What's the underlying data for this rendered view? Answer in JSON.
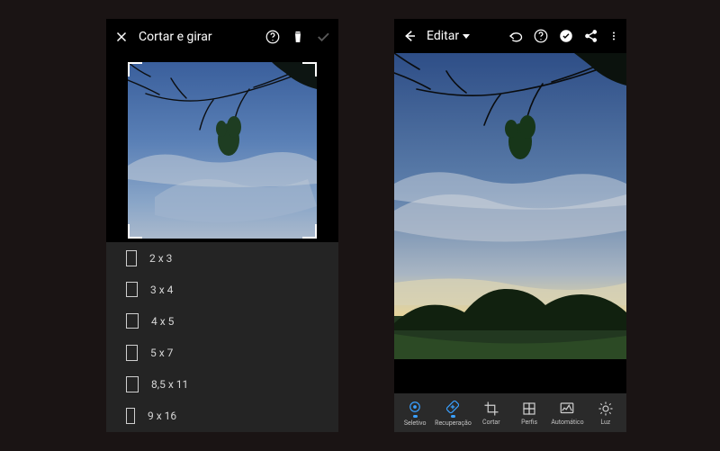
{
  "left": {
    "title": "Cortar e girar",
    "ratios": [
      {
        "label": "2 x 3",
        "cls": "r2x3"
      },
      {
        "label": "3 x 4",
        "cls": "r3x4"
      },
      {
        "label": "4 x 5",
        "cls": "r4x5"
      },
      {
        "label": "5 x 7",
        "cls": "r5x7"
      },
      {
        "label": "8,5 x 11",
        "cls": "r85x11"
      },
      {
        "label": "9 x 16",
        "cls": "r9x16"
      }
    ]
  },
  "right": {
    "editLabel": "Editar",
    "tools": [
      {
        "label": "Seletivo",
        "icon": "selective",
        "active": true
      },
      {
        "label": "Recuperação",
        "icon": "healing",
        "active": true
      },
      {
        "label": "Cortar",
        "icon": "crop",
        "active": false
      },
      {
        "label": "Perfis",
        "icon": "profiles",
        "active": false
      },
      {
        "label": "Automático",
        "icon": "auto",
        "active": false
      },
      {
        "label": "Luz",
        "icon": "light",
        "active": false
      }
    ]
  }
}
